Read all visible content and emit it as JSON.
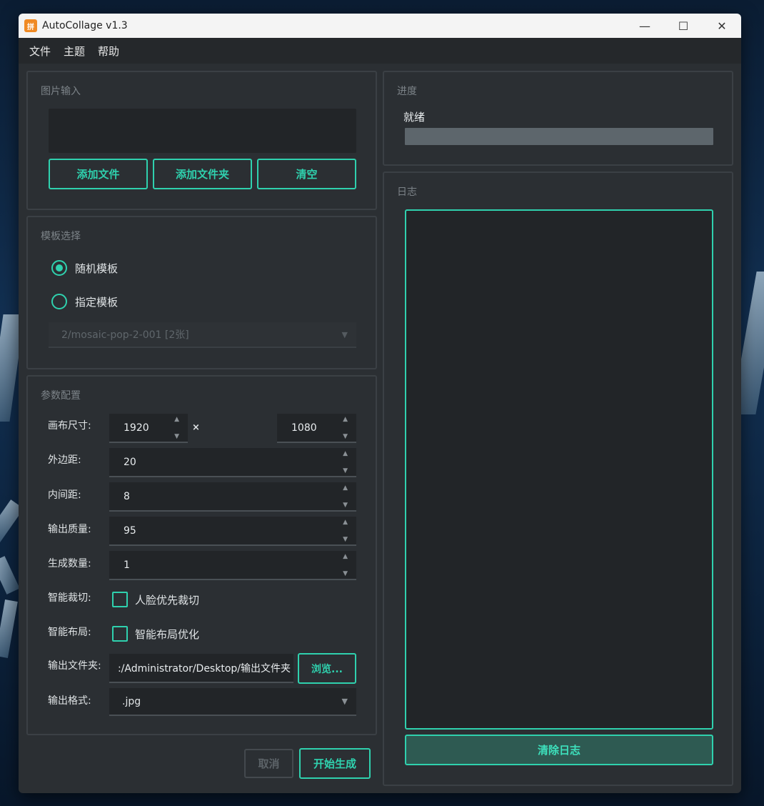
{
  "window": {
    "title": "AutoCollage v1.3",
    "icon_label": "拼图",
    "controls": {
      "minimize": "—",
      "maximize": "☐",
      "close": "✕"
    }
  },
  "menu": {
    "items": [
      "文件",
      "主题",
      "帮助"
    ]
  },
  "image_input": {
    "title": "图片输入",
    "buttons": {
      "add_files": "添加文件",
      "add_folder": "添加文件夹",
      "clear": "清空"
    }
  },
  "template": {
    "title": "模板选择",
    "random_label": "随机模板",
    "specified_label": "指定模板",
    "selected_option": "2/mosaic-pop-2-001 [2张]",
    "random_checked": true
  },
  "params": {
    "title": "参数配置",
    "canvas_label": "画布尺寸:",
    "canvas_width": "1920",
    "canvas_times": "×",
    "canvas_height": "1080",
    "margin_label": "外边距:",
    "margin_value": "20",
    "spacing_label": "内间距:",
    "spacing_value": "8",
    "quality_label": "输出质量:",
    "quality_value": "95",
    "count_label": "生成数量:",
    "count_value": "1",
    "smart_crop_label": "智能裁切:",
    "smart_crop_option": "人脸优先裁切",
    "smart_layout_label": "智能布局:",
    "smart_layout_option": "智能布局优化",
    "output_folder_label": "输出文件夹:",
    "output_folder_value": ":/Administrator/Desktop/输出文件夹",
    "browse_label": "浏览...",
    "format_label": "输出格式:",
    "format_value": ".jpg"
  },
  "actions": {
    "cancel": "取消",
    "start": "开始生成"
  },
  "progress": {
    "title": "进度",
    "status": "就绪",
    "fraction": 0
  },
  "log": {
    "title": "日志",
    "clear_button": "清除日志"
  },
  "colors": {
    "accent": "#2fd1ae",
    "panel": "#2b2f33",
    "field": "#222528"
  }
}
